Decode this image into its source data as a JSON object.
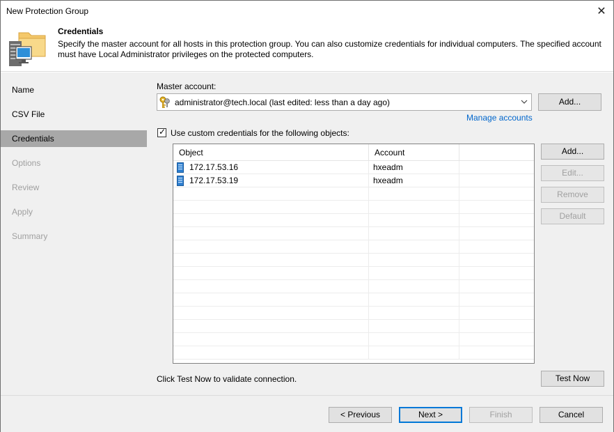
{
  "window": {
    "title": "New Protection Group",
    "close_glyph": "✕"
  },
  "header": {
    "title": "Credentials",
    "description": "Specify the master account for all hosts in this protection group. You can also customize credentials for individual computers. The specified account must have Local Administrator privileges on the protected computers.",
    "icon": "protection-group-folder-icon"
  },
  "sidebar": {
    "items": [
      {
        "label": "Name",
        "state": "enabled"
      },
      {
        "label": "CSV File",
        "state": "enabled"
      },
      {
        "label": "Credentials",
        "state": "active"
      },
      {
        "label": "Options",
        "state": "disabled"
      },
      {
        "label": "Review",
        "state": "disabled"
      },
      {
        "label": "Apply",
        "state": "disabled"
      },
      {
        "label": "Summary",
        "state": "disabled"
      }
    ]
  },
  "master_account": {
    "label": "Master account:",
    "value": "administrator@tech.local (last edited: less than a day ago)",
    "icon": "key-icon",
    "add_label": "Add...",
    "manage_link": "Manage accounts"
  },
  "custom_credentials": {
    "checkbox_label": "Use custom credentials for the following objects:",
    "checked": true,
    "columns": [
      "Object",
      "Account"
    ],
    "rows": [
      {
        "object": "172.17.53.16",
        "account": "hxeadm",
        "icon": "server-icon"
      },
      {
        "object": "172.17.53.19",
        "account": "hxeadm",
        "icon": "server-icon"
      }
    ],
    "buttons": {
      "add": "Add...",
      "edit": "Edit...",
      "remove": "Remove",
      "default": "Default"
    }
  },
  "test": {
    "hint": "Click Test Now to validate connection.",
    "button": "Test Now"
  },
  "footer": {
    "previous": "< Previous",
    "next": "Next >",
    "finish": "Finish",
    "cancel": "Cancel"
  },
  "colors": {
    "accent": "#0078d7",
    "link": "#0066cc",
    "sidebar_active": "#a8a8a8",
    "panel": "#f0f0f0"
  }
}
